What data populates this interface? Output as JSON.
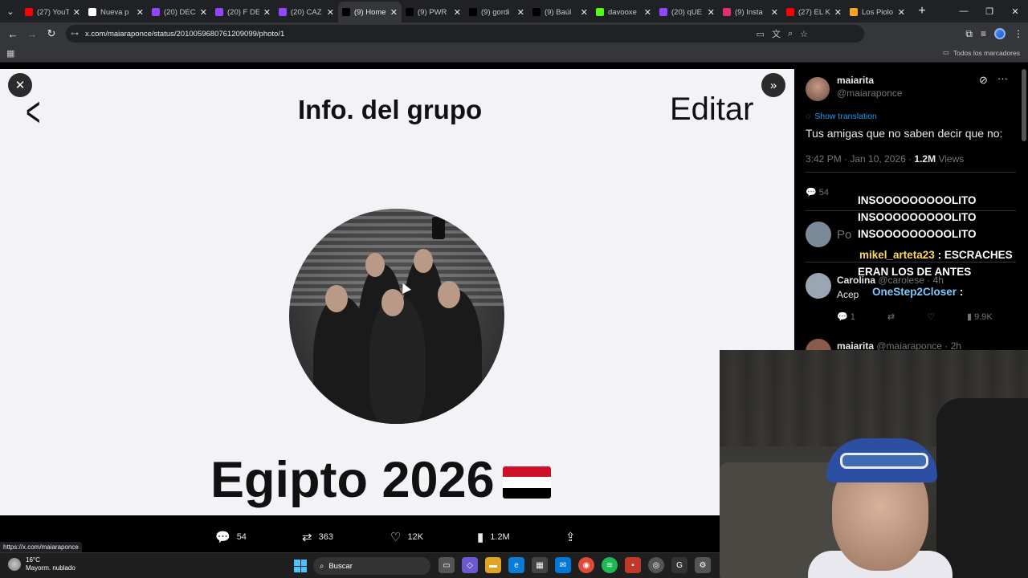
{
  "browser": {
    "tabs": [
      {
        "label": "(27) YouT",
        "color": "#ff0000",
        "active": false
      },
      {
        "label": "Nueva p",
        "color": "#ffffff",
        "active": false
      },
      {
        "label": "(20) DEC",
        "color": "#9146ff",
        "active": false
      },
      {
        "label": "(20) F DE",
        "color": "#9146ff",
        "active": false
      },
      {
        "label": "(20) CAZ",
        "color": "#9146ff",
        "active": false
      },
      {
        "label": "(9) Home",
        "color": "#000000",
        "active": true
      },
      {
        "label": "(9) PWR",
        "color": "#000000",
        "active": false
      },
      {
        "label": "(9) gordi",
        "color": "#000000",
        "active": false
      },
      {
        "label": "(9) Baúl",
        "color": "#000000",
        "active": false
      },
      {
        "label": "davooxe",
        "color": "#53fc18",
        "active": false
      },
      {
        "label": "(20) qUE",
        "color": "#9146ff",
        "active": false
      },
      {
        "label": "(9) Insta",
        "color": "#e1306c",
        "active": false
      },
      {
        "label": "(27) EL K",
        "color": "#ff0000",
        "active": false
      },
      {
        "label": "Los Piolo",
        "color": "#f5a623",
        "active": false
      }
    ],
    "new_tab": "+",
    "url": "x.com/maiaraponce/status/2010059680761209099/photo/1",
    "bookmarks_label": "Todos los marcadores",
    "status_url": "https://x.com/maiaraponce"
  },
  "group_screenshot": {
    "back": "<",
    "title": "Info. del grupo",
    "edit": "Editar",
    "name": "Egipto 2026",
    "flag_colors": [
      "#ce1126",
      "#ffffff",
      "#000000"
    ]
  },
  "actions": [
    {
      "icon": "reply-icon",
      "glyph": "💬",
      "count": "54"
    },
    {
      "icon": "repost-icon",
      "glyph": "⇄",
      "count": "363"
    },
    {
      "icon": "like-icon",
      "glyph": "♡",
      "count": "12K"
    },
    {
      "icon": "views-icon",
      "glyph": "▮",
      "count": "1.2M"
    },
    {
      "icon": "share-icon",
      "glyph": "⇪",
      "count": ""
    }
  ],
  "post": {
    "name": "maiarita",
    "handle": "@maiaraponce",
    "translate": "Show translation",
    "text": "Tus amigas que no saben decir que no:",
    "time": "3:42 PM · Jan 10, 2026 · ",
    "views_count": "1.2M",
    "views_label": " Views",
    "reply_count": "54",
    "reply_placeholder": "Po",
    "replies": [
      {
        "name": "Carolina",
        "handle": "@carolese · 4h",
        "text": "Acep",
        "avatar": "#9aa6b2"
      },
      {
        "name": "maiarita",
        "handle": "@maiaraponce · 2h",
        "text": "",
        "avatar": "#8a5a4a"
      }
    ],
    "reply_stats": [
      "1",
      "9.9K"
    ]
  },
  "chat": [
    {
      "user": "",
      "text": "INSOOOOOOOOOLITO"
    },
    {
      "user": "",
      "text": "INSOOOOOOOOOLITO"
    },
    {
      "user": "",
      "text": "INSOOOOOOOOOLITO"
    },
    {
      "user": "mikel_arteta23",
      "text": ": ESCRACHES"
    },
    {
      "user": "",
      "text": "ERAN LOS DE ANTES"
    },
    {
      "user": "OneStep2Closer",
      "text": ":"
    }
  ],
  "taskbar": {
    "temp": "16°C",
    "weather": "Mayorm. nublado",
    "search": "Buscar"
  }
}
